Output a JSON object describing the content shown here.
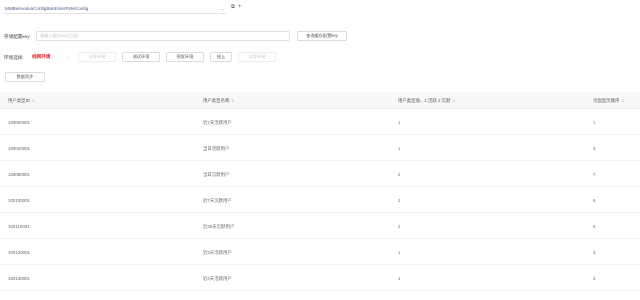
{
  "topbar": {
    "config_value": "MMBeInvaluaConfigBanEnterRoleConfig",
    "chevron": "⌄",
    "copy_icon": "copy-icon",
    "refresh_icon": "refresh-icon",
    "add_icon": "add-icon"
  },
  "key_row": {
    "label": "存储配置key:",
    "placeholder": "请输入缓存key(可选)",
    "query_button": "查询缓存配置key"
  },
  "env_row": {
    "label": "环境选择:",
    "env_value": "线网环境",
    "chevron": "⌄",
    "buttons": [
      "开发环境",
      "测试环境",
      "预发环境",
      "线上",
      "灰度环境"
    ],
    "disabled": [
      true,
      false,
      false,
      false,
      true
    ]
  },
  "sync_button": "数据同步",
  "table": {
    "columns": [
      "用户类型ID",
      "用户类型名称",
      "用户类型值，1:活跃 2:沉默",
      "页面显示顺序"
    ],
    "rows": [
      [
        "100000001",
        "近7天活跃用户",
        "1",
        "1"
      ],
      [
        "100040001",
        "当日活跃用户",
        "1",
        "4"
      ],
      [
        "100050001",
        "当日沉默用户",
        "2",
        "7"
      ],
      [
        "100100001",
        "近7天沉默用户",
        "2",
        "6"
      ],
      [
        "100110001",
        "近30天沉默用户",
        "2",
        "5"
      ],
      [
        "100120001",
        "近3天活跃用户",
        "1",
        "3"
      ],
      [
        "100130001",
        "近3天活跃用户",
        "1",
        "2"
      ]
    ]
  },
  "colors": {
    "accent_red": "#e0242f",
    "header_bg": "#f7f8fa",
    "border": "#e2e2e2"
  }
}
